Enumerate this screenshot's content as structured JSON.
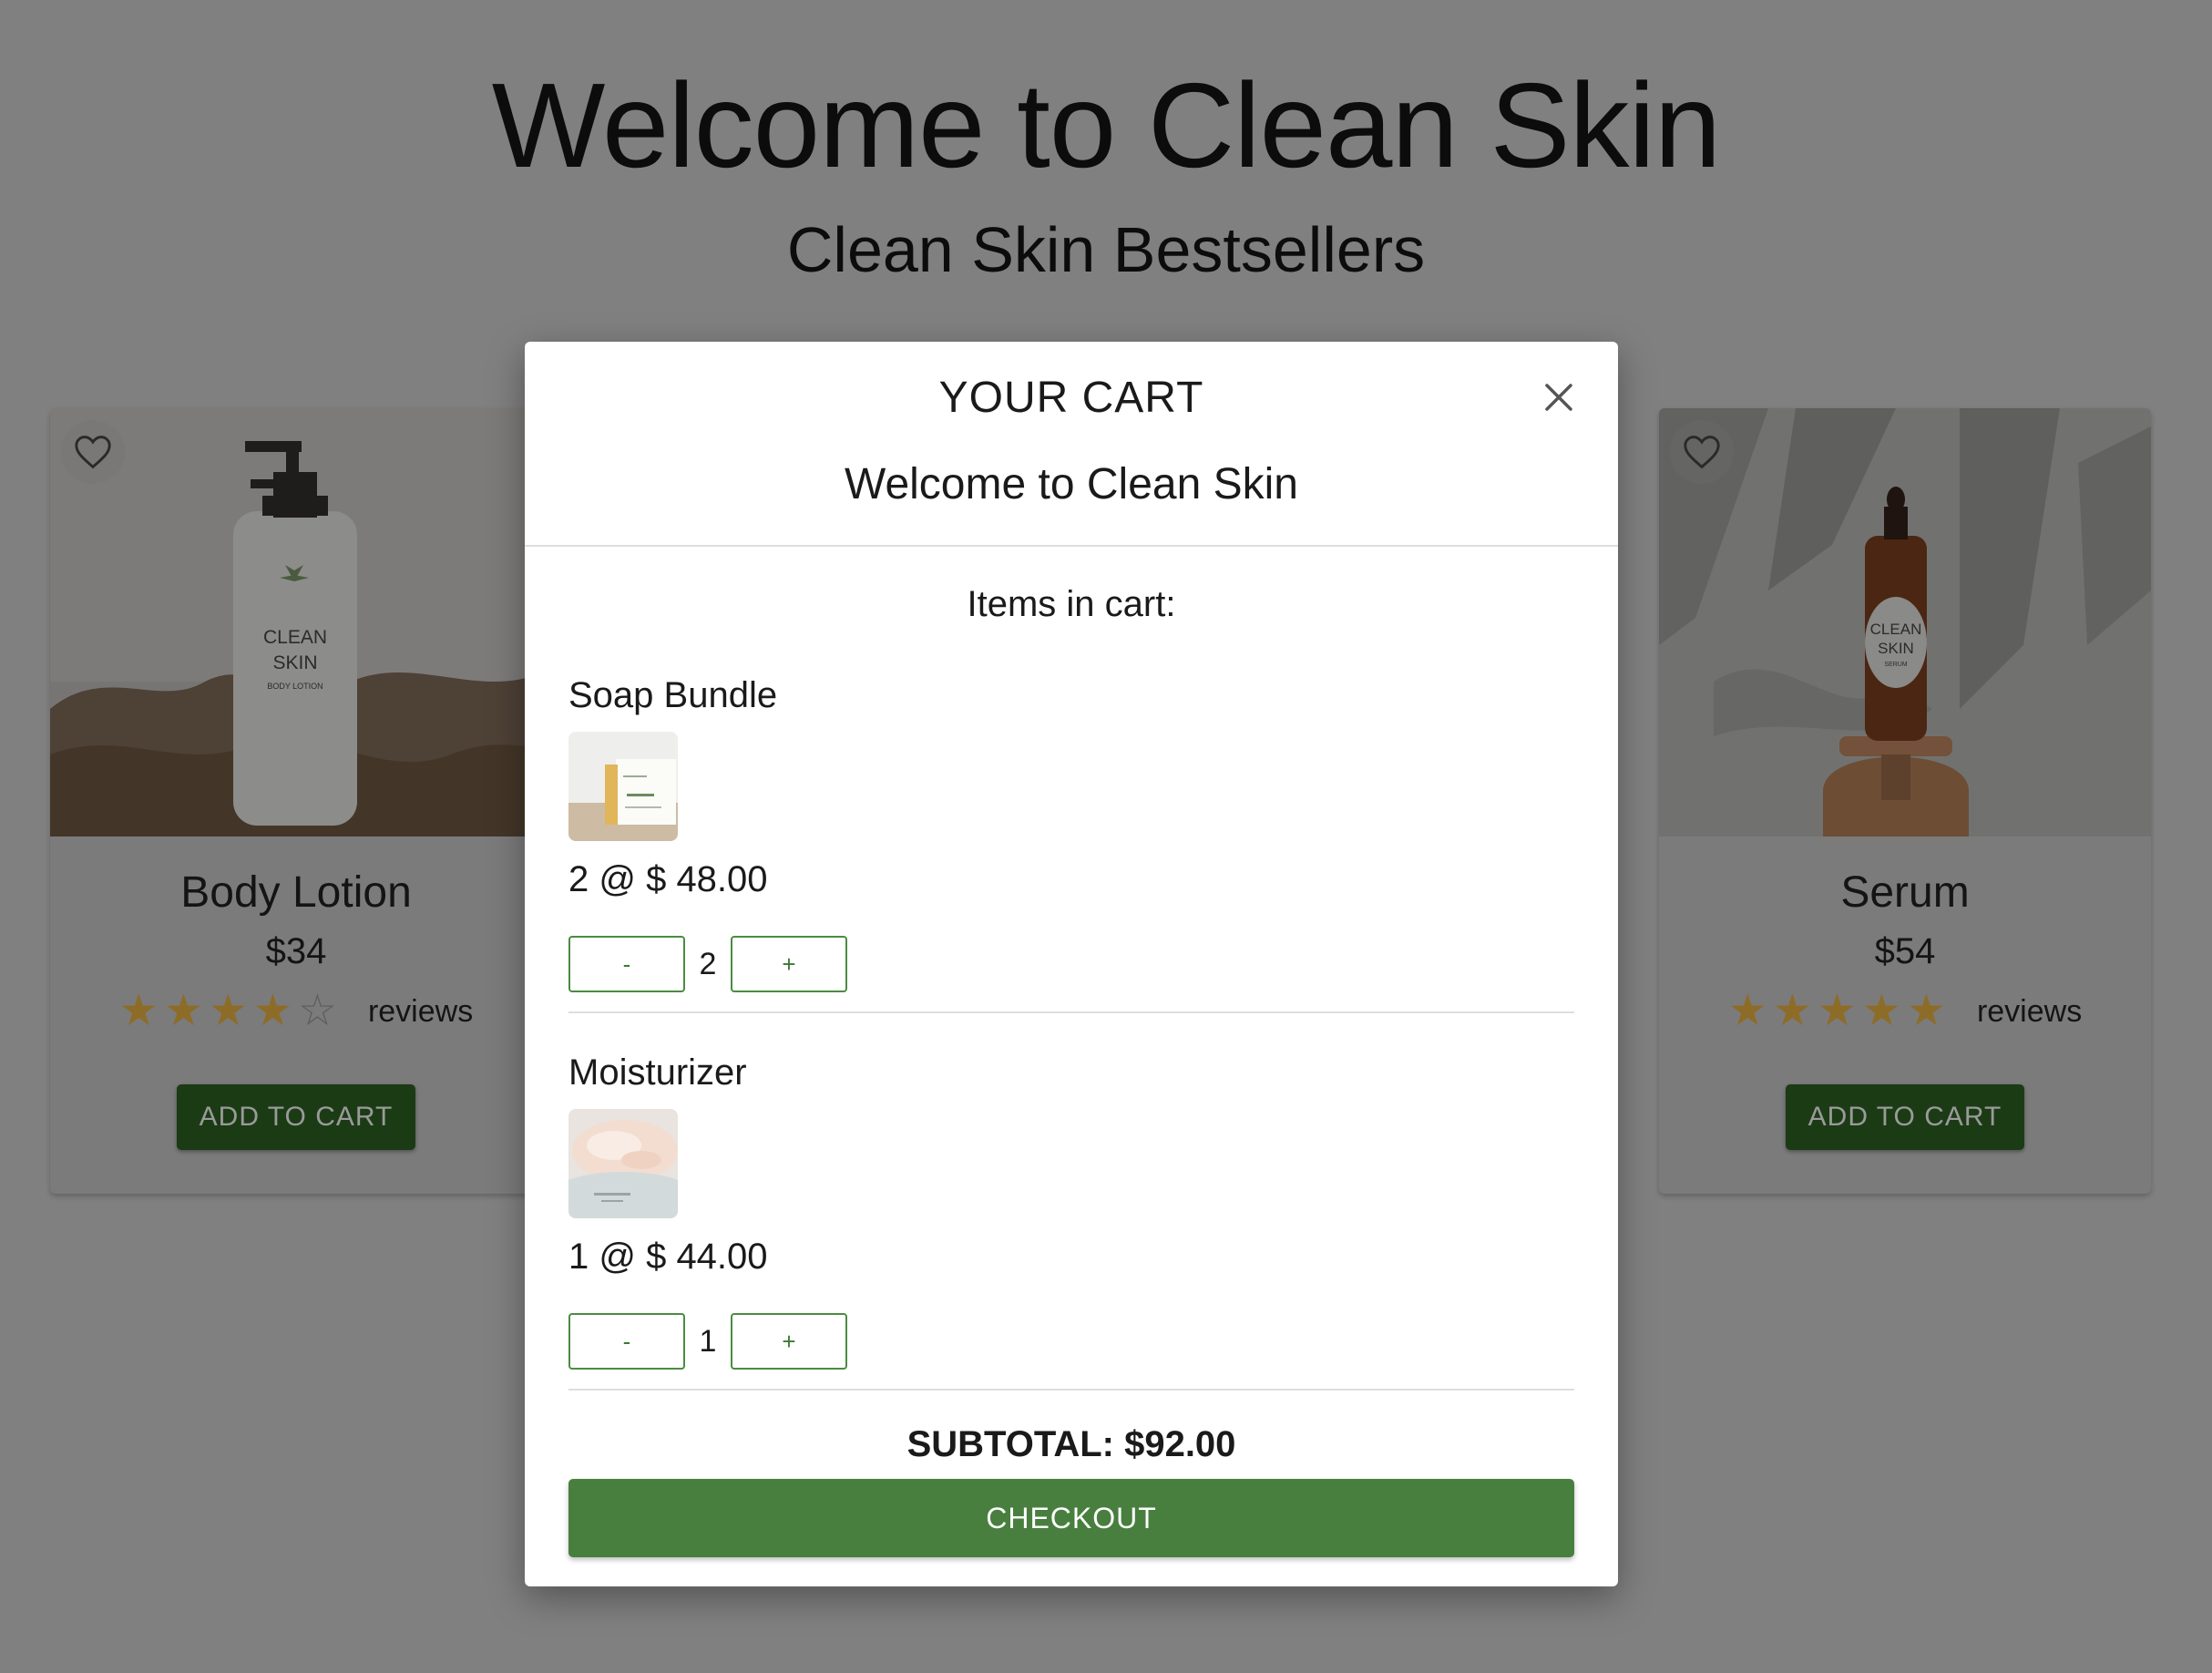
{
  "page": {
    "title": "Welcome to Clean Skin",
    "section_title": "Clean Skin Bestsellers"
  },
  "products": [
    {
      "name": "Body Lotion",
      "price": "$34",
      "rating": 4,
      "reviews_label": "reviews",
      "add_to_cart_label": "ADD TO CART",
      "image_label": [
        "CLEAN",
        "SKIN",
        "BODY LOTION"
      ],
      "favorite_icon": "heart-outline-icon"
    },
    {
      "name": "Serum",
      "price": "$54",
      "rating": 5,
      "reviews_label": "reviews",
      "add_to_cart_label": "ADD TO CART",
      "image_label": [
        "CLEAN",
        "SKIN",
        "SERUM"
      ],
      "favorite_icon": "heart-outline-icon"
    }
  ],
  "cart": {
    "title": "YOUR CART",
    "subtitle": "Welcome to Clean Skin",
    "close_icon": "close-icon",
    "items_heading": "Items in cart:",
    "items": [
      {
        "name": "Soap Bundle",
        "price_line": "2 @ $ 48.00",
        "quantity": "2",
        "decrement_label": "-",
        "increment_label": "+"
      },
      {
        "name": "Moisturizer",
        "price_line": "1 @ $ 44.00",
        "quantity": "1",
        "decrement_label": "-",
        "increment_label": "+"
      }
    ],
    "subtotal": "SUBTOTAL: $92.00",
    "checkout_label": "CHECKOUT"
  },
  "colors": {
    "overlay": "#808080",
    "accent_green": "#487f3f",
    "star": "#8d6c28"
  }
}
